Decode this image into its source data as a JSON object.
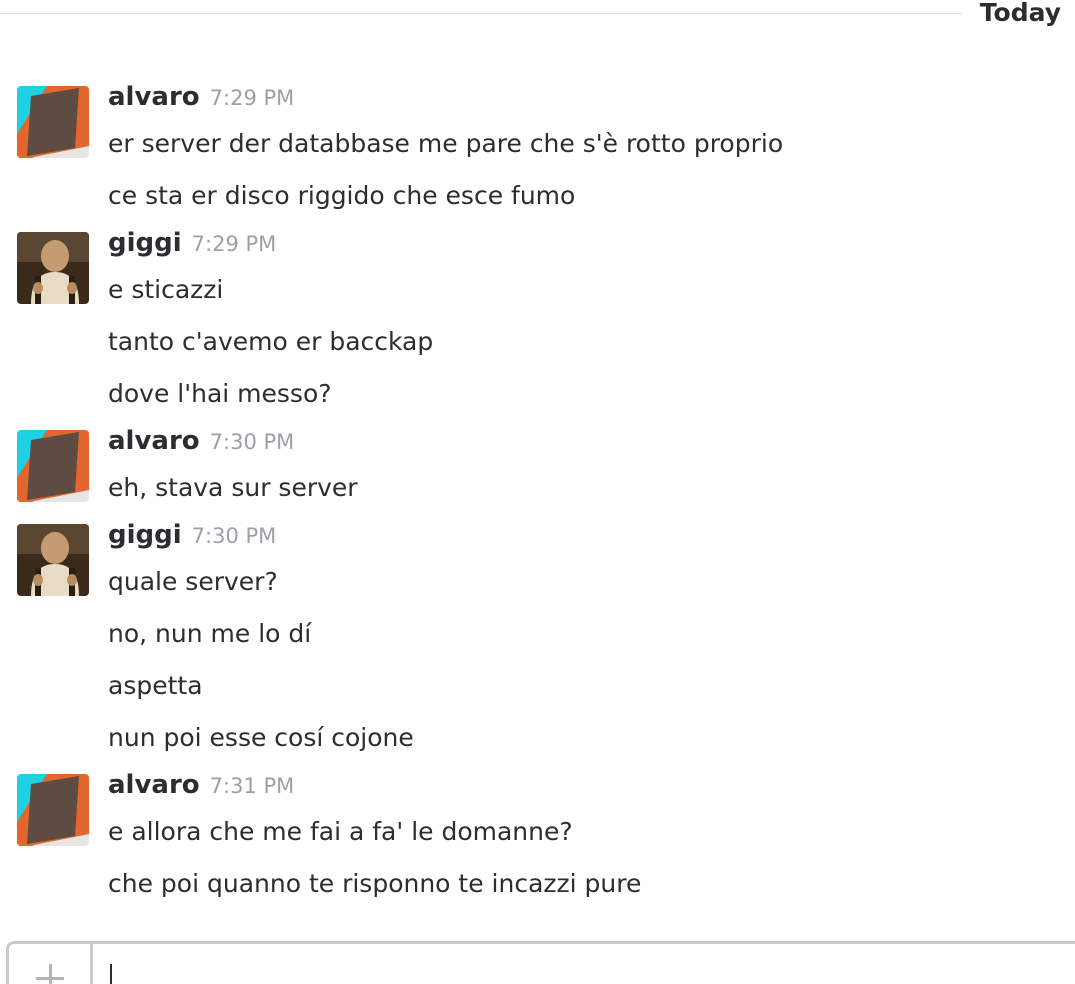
{
  "day_divider": {
    "label": "Today"
  },
  "colors": {
    "text": "#2c2d30",
    "timestamp": "#9e9ea6",
    "divider": "#e3e3e3",
    "avatar_alvaro_cyan": "#1ed0e4",
    "avatar_alvaro_orange": "#e2662e",
    "avatar_alvaro_brown": "#5e4b41"
  },
  "messages": [
    {
      "author": "alvaro",
      "time": "7:29 PM",
      "avatar": "alvaro-geometric-avatar",
      "lines": [
        "er server der databbase me pare che s'è rotto proprio",
        "ce sta er disco riggido che esce fumo"
      ]
    },
    {
      "author": "giggi",
      "time": "7:29 PM",
      "avatar": "giggi-photo-avatar",
      "lines": [
        "e sticazzi",
        "tanto c'avemo er bacckap",
        "dove l'hai messo?"
      ]
    },
    {
      "author": "alvaro",
      "time": "7:30 PM",
      "avatar": "alvaro-geometric-avatar",
      "lines": [
        "eh, stava sur server"
      ]
    },
    {
      "author": "giggi",
      "time": "7:30 PM",
      "avatar": "giggi-photo-avatar",
      "lines": [
        "quale server?",
        "no, nun me lo dí",
        "aspetta",
        "nun poi esse cosí cojone"
      ]
    },
    {
      "author": "alvaro",
      "time": "7:31 PM",
      "avatar": "alvaro-geometric-avatar",
      "lines": [
        "e allora che me fai a fa' le domanne?",
        "che poi quanno te risponno te incazzi pure"
      ]
    }
  ],
  "composer": {
    "value": "",
    "attach_icon": "plus-icon"
  }
}
